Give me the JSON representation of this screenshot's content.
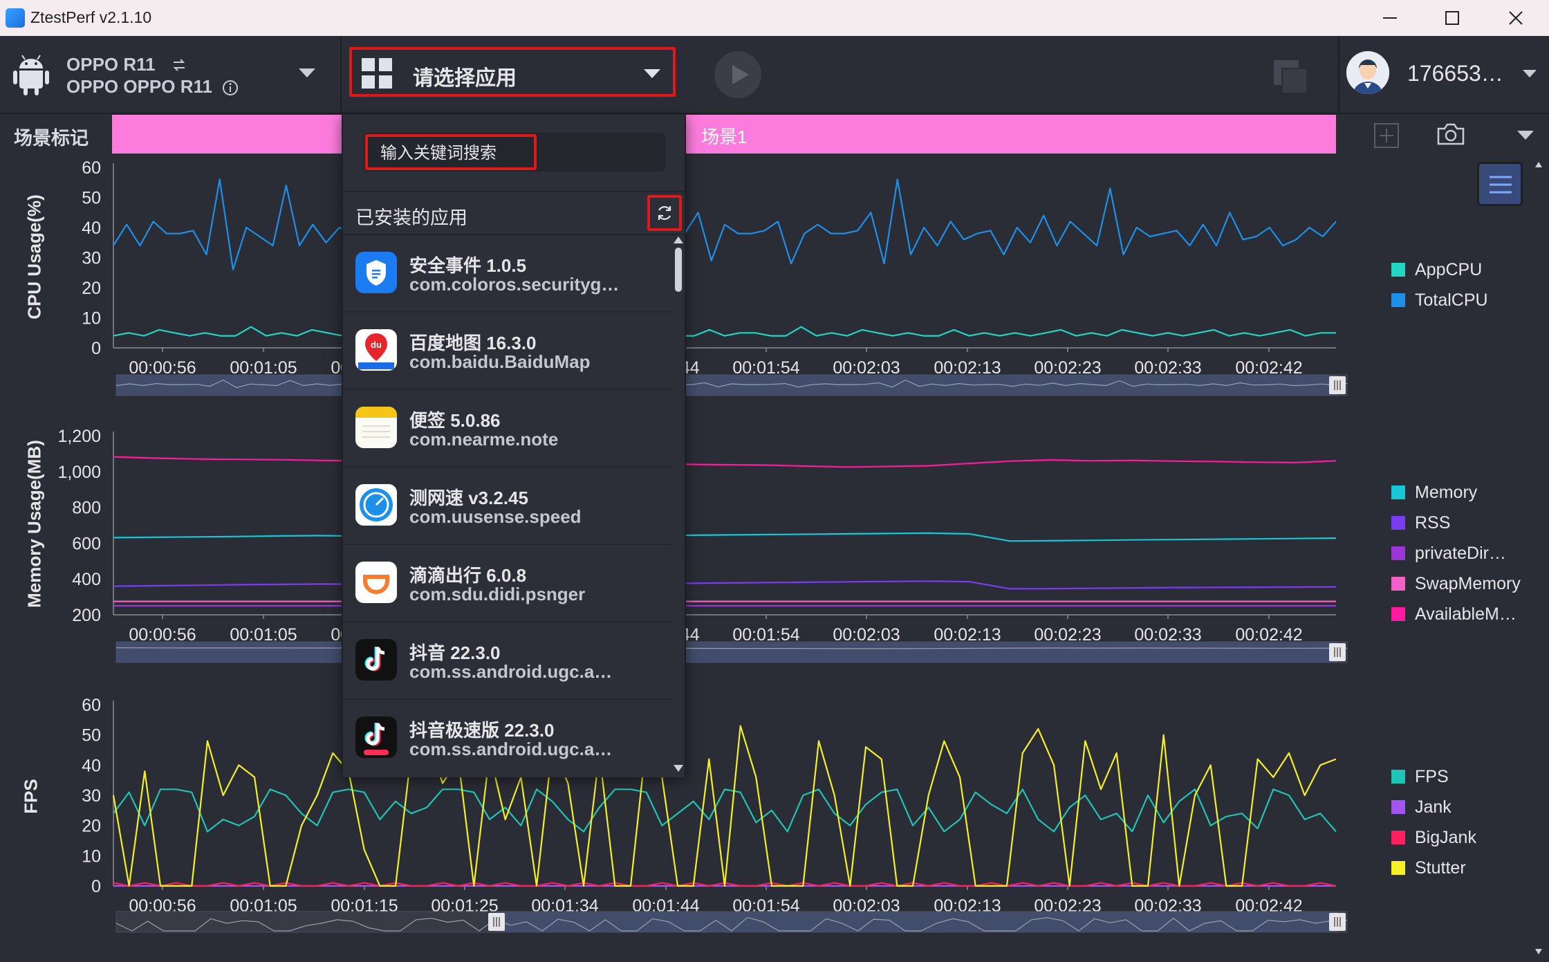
{
  "window": {
    "title": "ZtestPerf v2.1.10"
  },
  "device": {
    "model": "OPPO R11",
    "full_name": "OPPO OPPO R11"
  },
  "app_selector": {
    "label": "请选择应用"
  },
  "user": {
    "id": "176653…"
  },
  "scene": {
    "label": "场景标记",
    "name": "场景1",
    "bar_color": "#fb7cdc"
  },
  "dropdown": {
    "search_placeholder": "输入关键词搜索",
    "installed_title": "已安装的应用",
    "apps": [
      {
        "name": "安全事件 1.0.5",
        "package": "com.coloros.securityg…",
        "icon": "shield-icon"
      },
      {
        "name": "百度地图 16.3.0",
        "package": "com.baidu.BaiduMap",
        "icon": "baidu-map-icon"
      },
      {
        "name": "便签 5.0.86",
        "package": "com.nearme.note",
        "icon": "notes-icon"
      },
      {
        "name": "测网速 v3.2.45",
        "package": "com.uusense.speed",
        "icon": "speedometer-icon"
      },
      {
        "name": "滴滴出行 6.0.8",
        "package": "com.sdu.didi.psnger",
        "icon": "didi-icon"
      },
      {
        "name": "抖音 22.3.0",
        "package": "com.ss.android.ugc.a…",
        "icon": "tiktok-icon"
      },
      {
        "name": "抖音极速版 22.3.0",
        "package": "com.ss.android.ugc.a…",
        "icon": "tiktok-lite-icon"
      }
    ]
  },
  "chart_data": [
    {
      "type": "line",
      "ylabel": "CPU Usage(%)",
      "ylim": [
        0,
        60
      ],
      "yticks": [
        "60",
        "50",
        "40",
        "30",
        "20",
        "10",
        "0"
      ],
      "xticks": [
        "00:00:56",
        "00:01:05",
        "00:01:15",
        "00:01:25",
        "00:01:34",
        "00:01:44",
        "00:01:54",
        "00:02:03",
        "00:02:13",
        "00:02:23",
        "00:02:33",
        "00:02:42"
      ],
      "series": [
        {
          "name": "AppCPU",
          "color": "#23d6c4",
          "values": [
            4,
            5,
            4,
            6,
            5,
            4,
            5,
            4,
            4,
            7,
            4,
            5,
            4,
            6,
            5,
            4,
            5,
            5,
            4,
            6,
            4,
            5,
            4,
            5,
            4,
            5,
            6,
            4,
            5,
            4,
            5,
            6,
            5,
            4,
            5,
            4,
            5,
            4,
            4,
            6,
            4,
            5,
            5,
            4,
            4,
            7,
            4,
            5,
            4,
            6,
            5,
            4,
            5,
            4,
            4,
            6,
            4,
            5,
            4,
            5,
            4,
            5,
            6,
            4,
            5,
            4,
            6,
            5,
            4,
            5,
            4,
            5,
            6,
            4,
            5,
            4,
            5,
            6,
            4,
            5,
            5
          ]
        },
        {
          "name": "TotalCPU",
          "color": "#1e90e8",
          "values": [
            34,
            41,
            34,
            42,
            38,
            38,
            39,
            31,
            56,
            26,
            40,
            37,
            34,
            54,
            34,
            41,
            35,
            40,
            38,
            38,
            39,
            31,
            50,
            28,
            40,
            37,
            34,
            50,
            30,
            42,
            38,
            38,
            39,
            31,
            50,
            28,
            40,
            37,
            34,
            48,
            35,
            41,
            38,
            38,
            45,
            29,
            41,
            38,
            38,
            39,
            42,
            28,
            38,
            41,
            38,
            38,
            39,
            45,
            28,
            56,
            31,
            40,
            34,
            42,
            36,
            38,
            39,
            31,
            40,
            35,
            44,
            34,
            42,
            38,
            34,
            53,
            31,
            40,
            37,
            38,
            39,
            34,
            41,
            34,
            45,
            36,
            37,
            40,
            34,
            36,
            40,
            37,
            42
          ]
        }
      ]
    },
    {
      "type": "line",
      "ylabel": "Memory Usage(MB)",
      "ylim": [
        200,
        1200
      ],
      "yticks": [
        "1,200",
        "1,000",
        "800",
        "600",
        "400",
        "200"
      ],
      "xticks": [
        "00:00:56",
        "00:01:05",
        "00:01:15",
        "00:01:25",
        "00:01:34",
        "00:01:44",
        "00:01:54",
        "00:02:03",
        "00:02:13",
        "00:02:23",
        "00:02:33",
        "00:02:42"
      ],
      "series": [
        {
          "name": "Memory",
          "color": "#19c6d8",
          "values": [
            631,
            633,
            635,
            637,
            640,
            642,
            640,
            638,
            636,
            635,
            636,
            638,
            640,
            642,
            644,
            646,
            648,
            650,
            652,
            654,
            656,
            652,
            612,
            614,
            616,
            618,
            620,
            622,
            624,
            626,
            628
          ]
        },
        {
          "name": "RSS",
          "color": "#7a3cf0",
          "values": [
            360,
            362,
            365,
            368,
            370,
            372,
            372,
            370,
            368,
            367,
            368,
            370,
            372,
            374,
            376,
            378,
            380,
            382,
            384,
            386,
            388,
            385,
            345,
            346,
            348,
            350,
            352,
            353,
            354,
            355,
            356
          ]
        },
        {
          "name": "privateDir…",
          "color": "#9a36d8",
          "values": [
            250,
            250,
            250,
            250,
            250,
            250,
            250,
            250,
            250,
            250,
            250,
            250,
            250,
            250,
            250,
            250,
            250,
            250,
            250,
            250,
            250,
            250,
            250,
            250,
            250,
            250,
            250,
            250,
            250,
            250,
            250
          ]
        },
        {
          "name": "SwapMemory",
          "color": "#f460c8",
          "values": [
            275,
            275,
            275,
            275,
            275,
            275,
            275,
            275,
            275,
            275,
            275,
            275,
            275,
            275,
            275,
            275,
            275,
            275,
            275,
            275,
            275,
            275,
            275,
            275,
            275,
            275,
            275,
            275,
            275,
            275,
            275
          ]
        },
        {
          "name": "AvailableM…",
          "color": "#ff1aa0",
          "values": [
            1082,
            1075,
            1070,
            1068,
            1066,
            1062,
            1060,
            1058,
            1060,
            1056,
            1052,
            1050,
            1048,
            1045,
            1040,
            1038,
            1036,
            1030,
            1025,
            1028,
            1032,
            1045,
            1058,
            1065,
            1060,
            1062,
            1058,
            1056,
            1052,
            1050,
            1060
          ]
        }
      ]
    },
    {
      "type": "line",
      "ylabel": "FPS",
      "ylim": [
        0,
        60
      ],
      "yticks": [
        "60",
        "50",
        "40",
        "30",
        "20",
        "10",
        "0"
      ],
      "xticks": [
        "00:00:56",
        "00:01:05",
        "00:01:15",
        "00:01:25",
        "00:01:34",
        "00:01:44",
        "00:01:54",
        "00:02:03",
        "00:02:13",
        "00:02:23",
        "00:02:33",
        "00:02:42"
      ],
      "series": [
        {
          "name": "FPS",
          "color": "#1fc4b4",
          "values": [
            24,
            31,
            20,
            32,
            32,
            31,
            18,
            22,
            20,
            23,
            32,
            30,
            24,
            20,
            31,
            32,
            31,
            22,
            28,
            24,
            26,
            32,
            32,
            31,
            22,
            26,
            20,
            32,
            28,
            22,
            18,
            26,
            32,
            32,
            31,
            20,
            24,
            28,
            22,
            32,
            31,
            21,
            25,
            18,
            30,
            32,
            24,
            20,
            27,
            31,
            32,
            20,
            26,
            18,
            22,
            31,
            27,
            24,
            32,
            22,
            18,
            26,
            30,
            22,
            24,
            18,
            30,
            21,
            28,
            32,
            20,
            23,
            24,
            19,
            32,
            30,
            22,
            24,
            18
          ]
        },
        {
          "name": "Jank",
          "color": "#a455f0",
          "values": [
            0,
            0,
            0,
            0,
            0,
            0,
            0,
            0,
            0,
            0,
            0,
            0,
            0,
            0,
            0,
            0,
            0,
            0,
            0,
            0,
            0,
            0,
            0,
            0,
            0,
            0,
            0,
            0,
            0,
            0,
            0,
            0,
            0,
            0,
            0,
            0,
            0,
            0,
            0,
            0,
            0,
            0,
            0,
            0,
            0,
            0,
            0,
            0,
            0,
            0,
            0,
            0,
            0,
            0,
            0,
            0,
            0,
            0,
            0,
            0,
            0,
            0,
            0,
            0,
            0,
            0,
            0,
            0,
            0,
            0,
            0,
            0,
            0,
            0,
            0,
            0,
            0,
            0,
            0
          ]
        },
        {
          "name": "BigJank",
          "color": "#ff2060",
          "values": [
            1,
            0,
            1,
            0,
            1,
            0,
            0,
            1,
            0,
            1,
            0,
            1,
            0,
            0,
            1,
            0,
            1,
            0,
            1,
            0,
            0,
            1,
            0,
            1,
            0,
            1,
            0,
            0,
            1,
            0,
            1,
            0,
            1,
            0,
            0,
            1,
            0,
            1,
            0,
            1,
            0,
            0,
            1,
            0,
            1,
            0,
            1,
            0,
            0,
            1,
            0,
            1,
            0,
            1,
            0,
            0,
            1,
            0,
            1,
            0,
            1,
            0,
            0,
            1,
            0,
            1,
            0,
            1,
            0,
            0,
            1,
            0,
            1,
            0,
            1,
            0,
            0,
            1,
            0
          ]
        },
        {
          "name": "Stutter",
          "color": "#f5f025",
          "values": [
            30,
            0,
            38,
            0,
            0,
            0,
            48,
            30,
            40,
            36,
            0,
            0,
            20,
            30,
            44,
            38,
            12,
            0,
            0,
            44,
            50,
            34,
            42,
            0,
            44,
            22,
            36,
            0,
            46,
            34,
            0,
            44,
            0,
            0,
            48,
            36,
            0,
            0,
            42,
            0,
            53,
            36,
            0,
            0,
            0,
            48,
            30,
            0,
            46,
            42,
            0,
            0,
            30,
            48,
            36,
            0,
            0,
            0,
            44,
            52,
            40,
            0,
            48,
            32,
            44,
            0,
            0,
            50,
            0,
            30,
            40,
            0,
            0,
            42,
            36,
            44,
            30,
            40,
            42
          ]
        }
      ]
    }
  ]
}
